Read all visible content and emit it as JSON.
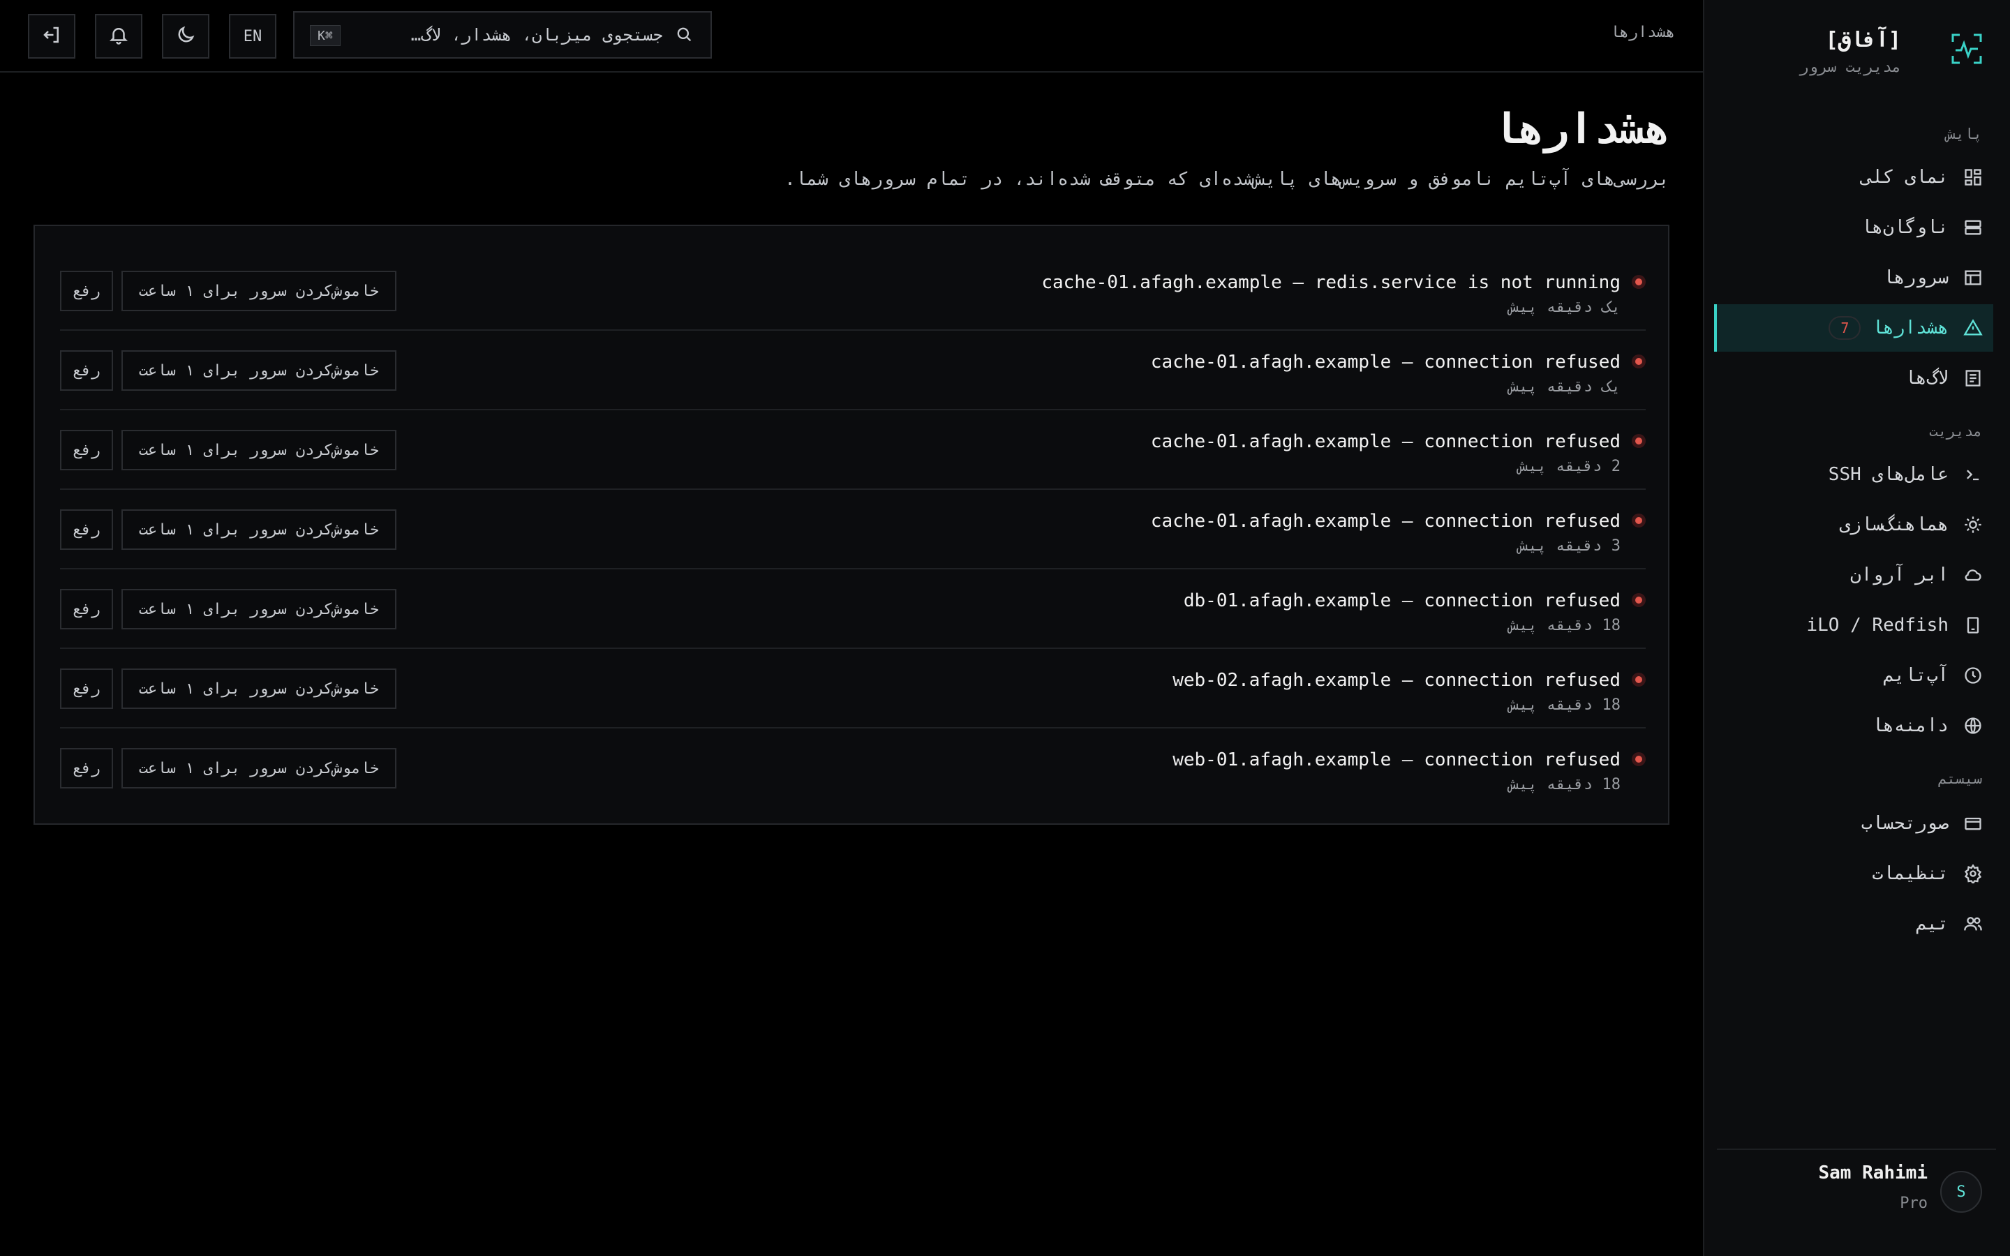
{
  "brand": {
    "name": "[آفاق]",
    "subtitle": "مدیریت سرور",
    "icon": "pulse-frame-icon"
  },
  "topbar": {
    "breadcrumb": "هشدارها",
    "search_placeholder": "جستجوی میزبان، هشدار، لاگ…",
    "search_shortcut": "⌘K",
    "lang_label": "EN",
    "icons": [
      "logout-icon",
      "bell-icon",
      "moon-icon"
    ]
  },
  "sidebar": {
    "sections": [
      {
        "title": "پایش"
      },
      {
        "title": "مدیریت"
      },
      {
        "title": "سیستم"
      }
    ],
    "items": [
      {
        "label": "نمای کلی",
        "icon": "grid-icon"
      },
      {
        "label": "ناوگان‌ها",
        "icon": "server-stack-icon"
      },
      {
        "label": "سرورها",
        "icon": "table-icon"
      },
      {
        "label": "هشدارها",
        "icon": "warning-triangle-icon",
        "badge": "7",
        "active": true
      },
      {
        "label": "لاگ‌ها",
        "icon": "log-icon"
      },
      {
        "label": "عامل‌های SSH",
        "icon": "terminal-icon"
      },
      {
        "label": "هماهنگ‌سازی",
        "icon": "sun-sync-icon"
      },
      {
        "label": "ابر آروان",
        "icon": "cloud-icon"
      },
      {
        "label": "iLO / Redfish",
        "icon": "device-icon"
      },
      {
        "label": "آپ‌تایم",
        "icon": "clock-icon"
      },
      {
        "label": "دامنه‌ها",
        "icon": "globe-icon"
      },
      {
        "label": "صورتحساب",
        "icon": "card-icon"
      },
      {
        "label": "تنظیمات",
        "icon": "gear-icon"
      },
      {
        "label": "تیم",
        "icon": "users-icon"
      }
    ]
  },
  "user": {
    "initial": "S",
    "name": "Sam Rahimi",
    "plan": "Pro"
  },
  "main": {
    "title": "هشدارها",
    "subtitle": "بررسی‌های آپ‌تایم ناموفق و سرویس‌های پایش‌شده‌ای که متوقف شده‌اند، در تمام سرورهای شما.",
    "mute_label": "خاموش‌کردن سرور برای ۱ ساعت",
    "resolve_label": "رفع",
    "alerts": [
      {
        "title": "cache-01.afagh.example — redis.service is not running",
        "time": "یک دقیقه پیش"
      },
      {
        "title": "cache-01.afagh.example — connection refused",
        "time": "یک دقیقه پیش"
      },
      {
        "title": "cache-01.afagh.example — connection refused",
        "time": "2 دقیقه پیش"
      },
      {
        "title": "cache-01.afagh.example — connection refused",
        "time": "3 دقیقه پیش"
      },
      {
        "title": "db-01.afagh.example — connection refused",
        "time": "18 دقیقه پیش"
      },
      {
        "title": "web-02.afagh.example — connection refused",
        "time": "18 دقیقه پیش"
      },
      {
        "title": "web-01.afagh.example — connection refused",
        "time": "18 دقیقه پیش"
      }
    ]
  },
  "colors": {
    "accent": "#3ad2c7",
    "danger": "#e2574c",
    "background": "#000000",
    "sidebar": "#0c0d0f"
  }
}
